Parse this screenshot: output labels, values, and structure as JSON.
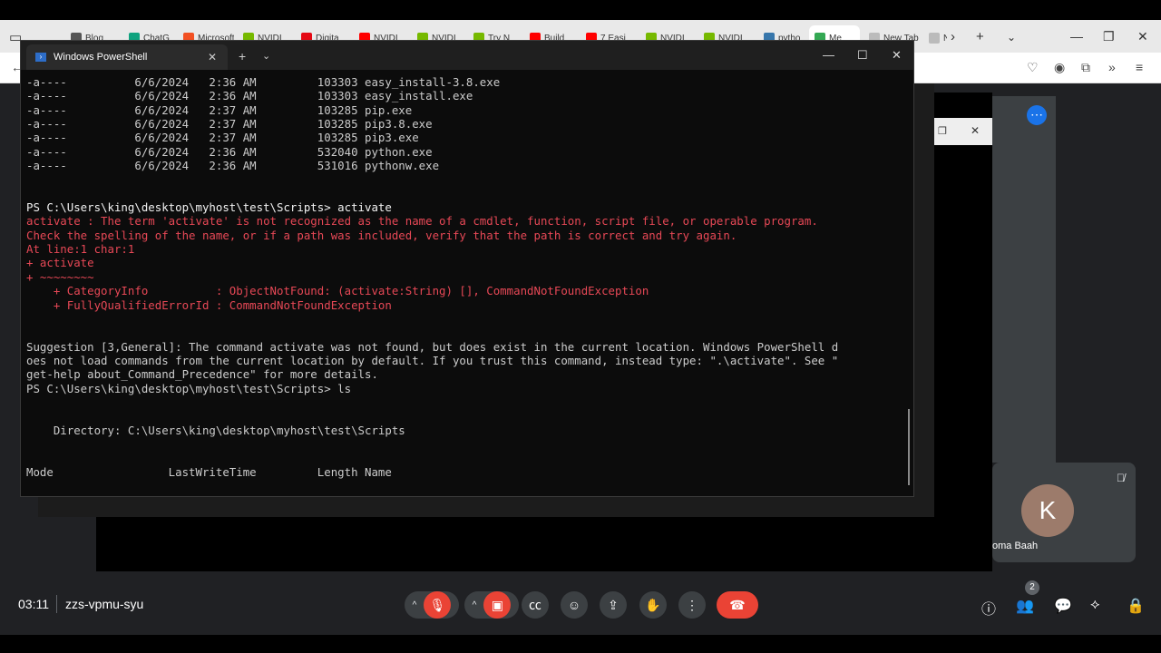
{
  "browser": {
    "tabs": [
      {
        "label": "Blog",
        "color": "#555"
      },
      {
        "label": "ChatG",
        "color": "#10a37f"
      },
      {
        "label": "Microsoft",
        "color": "#f25022"
      },
      {
        "label": "NVIDI",
        "color": "#76b900"
      },
      {
        "label": "Digita",
        "color": "#e50914"
      },
      {
        "label": "NVIDI",
        "color": "#ff0000"
      },
      {
        "label": "NVIDI",
        "color": "#76b900"
      },
      {
        "label": "Try N",
        "color": "#76b900"
      },
      {
        "label": "Build",
        "color": "#ff0000"
      },
      {
        "label": "7 Easi",
        "color": "#ff0000"
      },
      {
        "label": "NVIDI",
        "color": "#76b900"
      },
      {
        "label": "NVIDI",
        "color": "#76b900"
      },
      {
        "label": "pytho",
        "color": "#3776ab"
      },
      {
        "label": "Me",
        "color": "#34a853"
      },
      {
        "label": "New Tab",
        "color": "#bbb"
      },
      {
        "label": "Nev",
        "color": "#bbb"
      }
    ]
  },
  "powershell": {
    "title": "Windows PowerShell",
    "lines": [
      {
        "text": "-a----          6/6/2024   2:36 AM         103303 easy_install-3.8.exe",
        "style": "normal"
      },
      {
        "text": "-a----          6/6/2024   2:36 AM         103303 easy_install.exe",
        "style": "normal"
      },
      {
        "text": "-a----          6/6/2024   2:37 AM         103285 pip.exe",
        "style": "normal"
      },
      {
        "text": "-a----          6/6/2024   2:37 AM         103285 pip3.8.exe",
        "style": "normal"
      },
      {
        "text": "-a----          6/6/2024   2:37 AM         103285 pip3.exe",
        "style": "normal"
      },
      {
        "text": "-a----          6/6/2024   2:36 AM         532040 python.exe",
        "style": "normal"
      },
      {
        "text": "-a----          6/6/2024   2:36 AM         531016 pythonw.exe",
        "style": "normal"
      },
      {
        "text": "",
        "style": "normal"
      },
      {
        "text": "",
        "style": "normal"
      },
      {
        "text": "PS C:\\Users\\king\\desktop\\myhost\\test\\Scripts> activate",
        "style": "cmd"
      },
      {
        "text": "activate : The term 'activate' is not recognized as the name of a cmdlet, function, script file, or operable program.",
        "style": "err"
      },
      {
        "text": "Check the spelling of the name, or if a path was included, verify that the path is correct and try again.",
        "style": "err"
      },
      {
        "text": "At line:1 char:1",
        "style": "err"
      },
      {
        "text": "+ activate",
        "style": "err"
      },
      {
        "text": "+ ~~~~~~~~",
        "style": "err"
      },
      {
        "text": "    + CategoryInfo          : ObjectNotFound: (activate:String) [], CommandNotFoundException",
        "style": "err"
      },
      {
        "text": "    + FullyQualifiedErrorId : CommandNotFoundException",
        "style": "err"
      },
      {
        "text": "",
        "style": "normal"
      },
      {
        "text": "",
        "style": "normal"
      },
      {
        "text": "Suggestion [3,General]: The command activate was not found, but does exist in the current location. Windows PowerShell d",
        "style": "normal"
      },
      {
        "text": "oes not load commands from the current location by default. If you trust this command, instead type: \".\\activate\". See \"",
        "style": "normal"
      },
      {
        "text": "get-help about_Command_Precedence\" for more details.",
        "style": "normal"
      },
      {
        "text": "PS C:\\Users\\king\\desktop\\myhost\\test\\Scripts> ls",
        "style": "normal"
      },
      {
        "text": "",
        "style": "normal"
      },
      {
        "text": "",
        "style": "normal"
      },
      {
        "text": "    Directory: C:\\Users\\king\\desktop\\myhost\\test\\Scripts",
        "style": "normal"
      },
      {
        "text": "",
        "style": "normal"
      },
      {
        "text": "",
        "style": "normal"
      },
      {
        "text": "Mode                 LastWriteTime         Length Name",
        "style": "normal"
      }
    ]
  },
  "meeting": {
    "time": "03:11",
    "code": "zzs-vpmu-syu",
    "participant_initial": "K",
    "participant_name": "oma Baah",
    "people_count": "2",
    "more_icon": "⋯"
  },
  "colors": {
    "terminal_bg": "#0c0c0c",
    "error_text": "#e74856",
    "end_call": "#ea4335",
    "avatar_bg": "#9c7b6b"
  }
}
